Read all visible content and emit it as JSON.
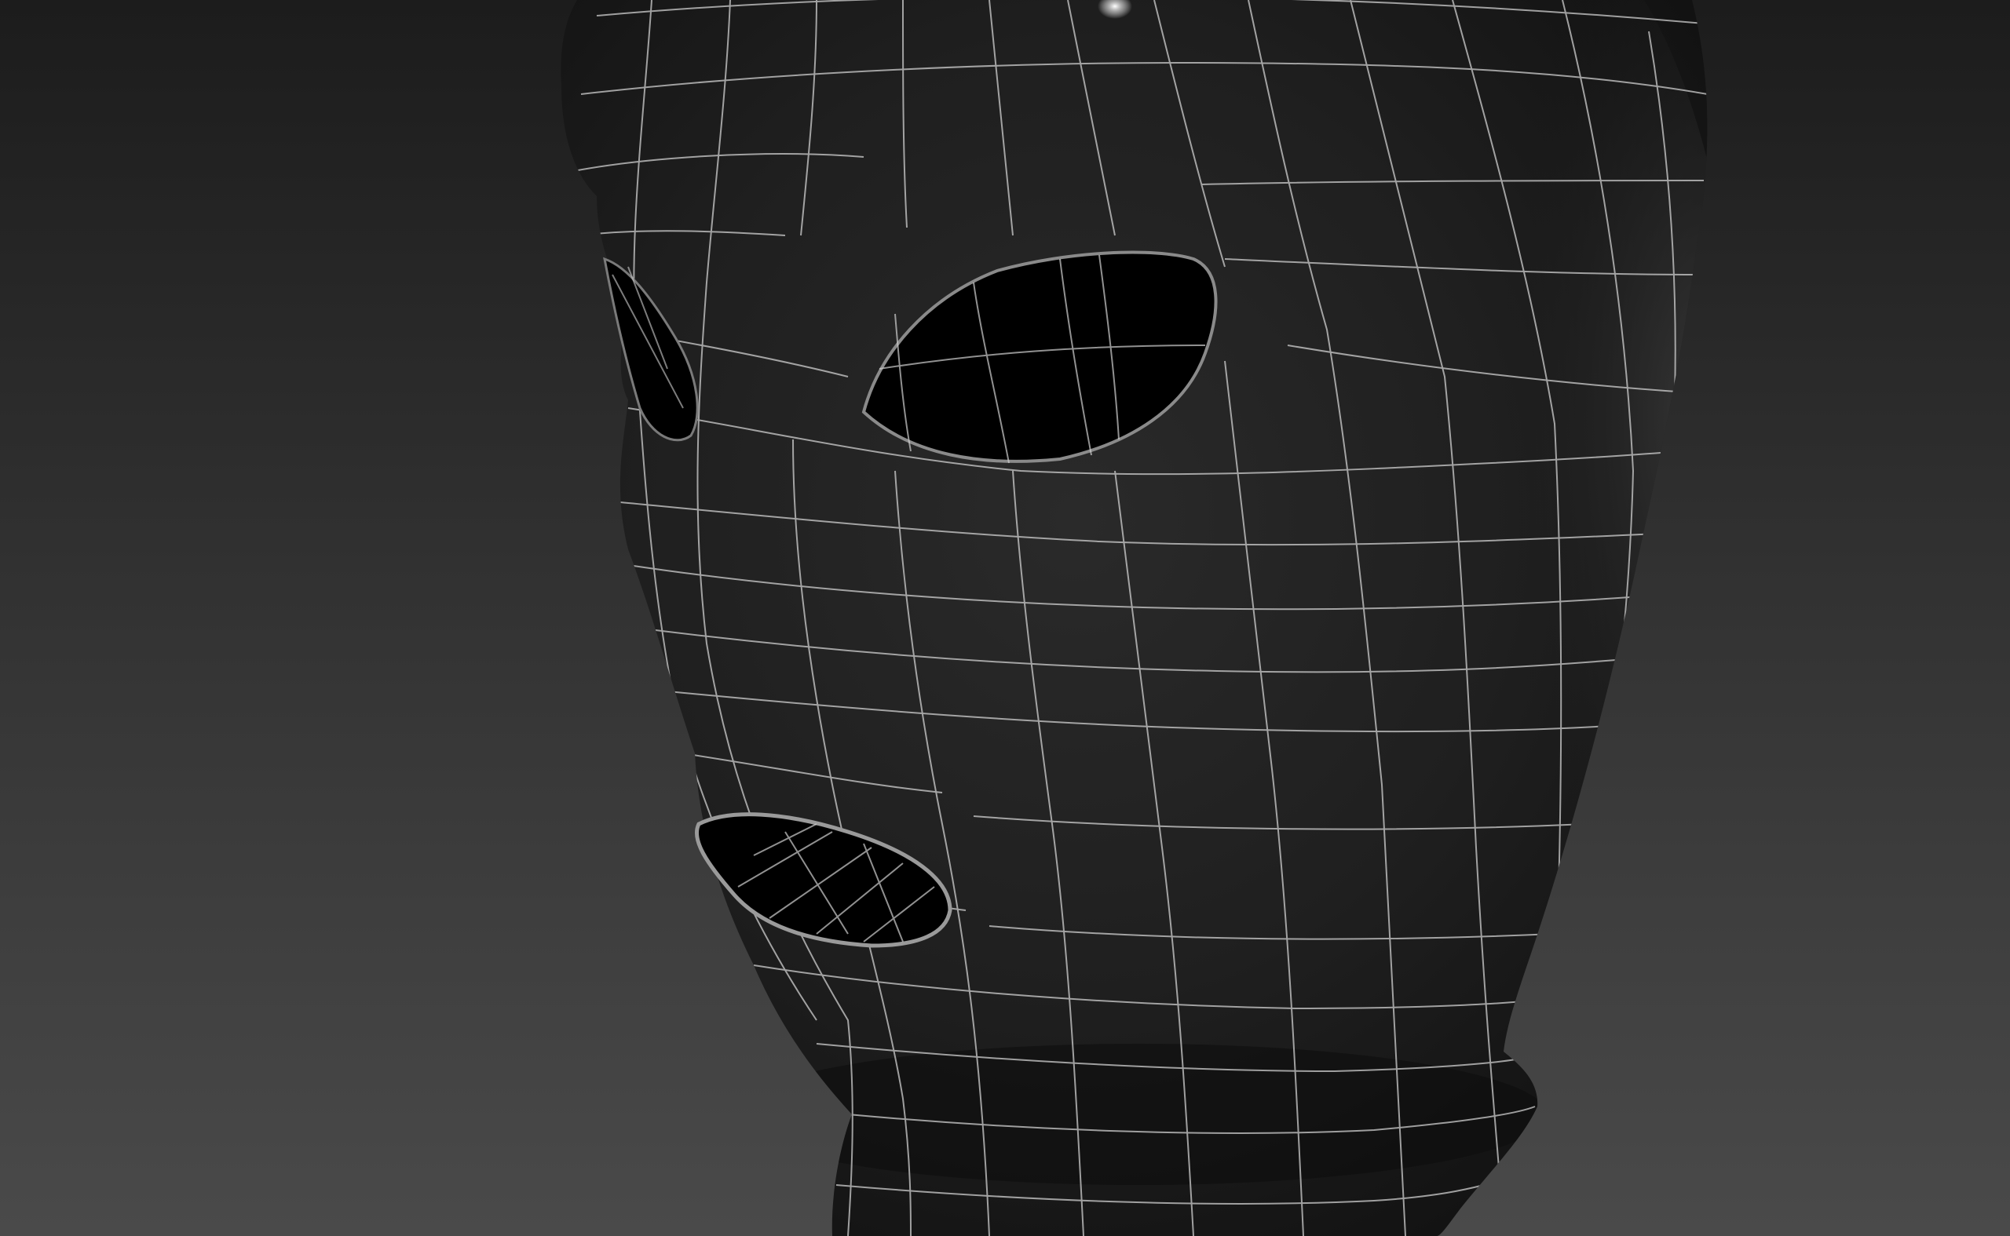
{
  "viewport": {
    "view": "3d-perspective-viewport",
    "shading": "smooth-shaded-with-wireframe-overlay",
    "background_top_color": "#1c1c1c",
    "background_bottom_color": "#4a4a4a"
  },
  "model": {
    "subject": "balaclava-mask",
    "surface_color": "#1a1a1a",
    "wire_color": "#cfcfcf",
    "hole_color": "#000000",
    "openings": [
      "left-eye-hole",
      "right-eye-hole",
      "mouth-hole"
    ]
  }
}
